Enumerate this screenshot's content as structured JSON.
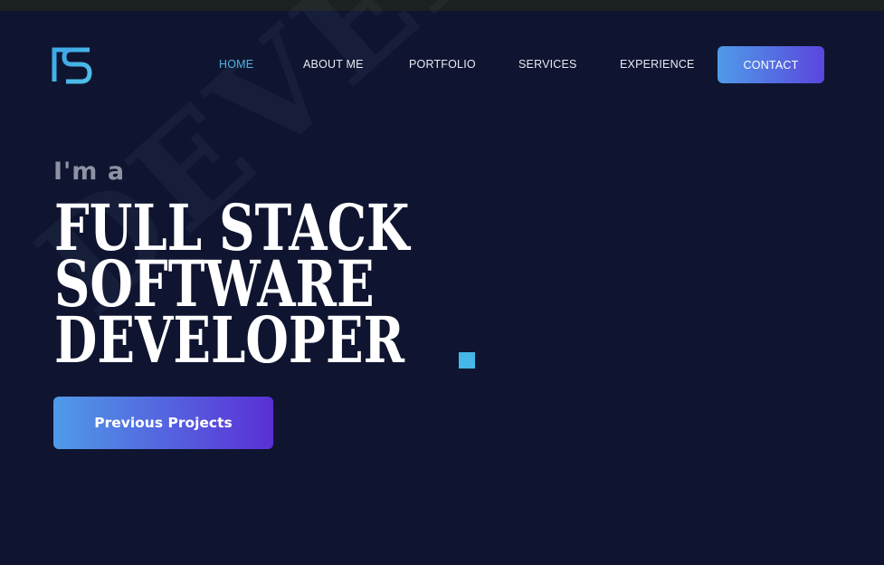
{
  "header": {
    "logo_icon": "fs-monogram-logo",
    "nav": [
      {
        "label": "HOME",
        "active": true
      },
      {
        "label": "ABOUT ME",
        "active": false
      },
      {
        "label": "PORTFOLIO",
        "active": false
      },
      {
        "label": "SERVICES",
        "active": false
      },
      {
        "label": "EXPERIENCE",
        "active": false
      }
    ],
    "contact_label": "CONTACT"
  },
  "hero": {
    "intro": "I'm a",
    "headline": [
      "Full Stack",
      "Software",
      "Developer"
    ],
    "watermark": "DEVELOPER",
    "cta_label": "Previous Projects"
  },
  "colors": {
    "background": "#0f1530",
    "accent": "#4fb4e6",
    "gradient_start": "#4f9be8",
    "gradient_end": "#5a2fd6",
    "text": "#ffffff",
    "intro_text": "#8d93a3"
  }
}
